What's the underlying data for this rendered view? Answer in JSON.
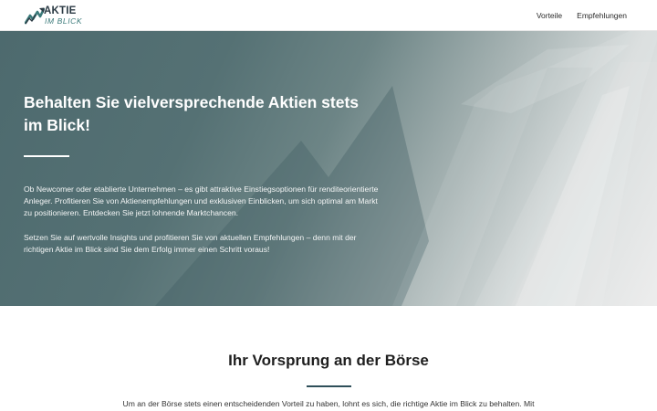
{
  "header": {
    "logo": {
      "line1": "AKTIE",
      "line2": "IM BLICK"
    },
    "nav": [
      {
        "label": "Vorteile"
      },
      {
        "label": "Empfehlungen"
      }
    ]
  },
  "hero": {
    "title": "Behalten Sie vielversprechende Aktien stets im Blick!",
    "paragraphs": [
      "Ob Newcomer oder etablierte Unternehmen – es gibt attraktive Einstiegsoptionen für renditeorientierte Anleger. Profitieren Sie von Aktienempfehlungen und exklusiven Einblicken, um sich optimal am Markt zu positionieren. Entdecken Sie jetzt lohnende Marktchancen.",
      "Setzen Sie auf wertvolle Insights und profitieren Sie von aktuellen Empfehlungen – denn mit der richtigen Aktie im Blick sind Sie dem Erfolg immer einen Schritt voraus!"
    ]
  },
  "section": {
    "title": "Ihr Vorsprung an der Börse",
    "text": "Um an der Börse stets einen entscheidenden Vorteil zu haben, lohnt es sich, die richtige Aktie im Blick zu behalten. Mit"
  },
  "colors": {
    "brand_dark": "#2b3a44",
    "brand_teal": "#3b7a7a",
    "hero_base": "#4d6a6e",
    "rule_accent": "#2f4f5a"
  }
}
